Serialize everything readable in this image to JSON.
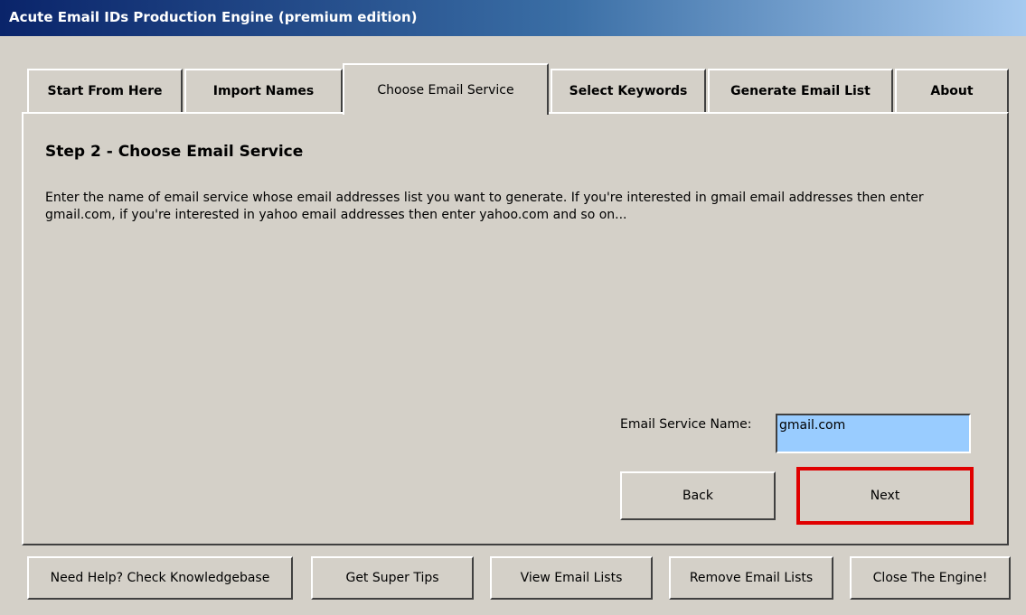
{
  "window": {
    "title": "Acute Email IDs Production Engine (premium edition)"
  },
  "tabs": [
    {
      "label": "Start From Here",
      "active": false
    },
    {
      "label": "Import Names",
      "active": false
    },
    {
      "label": "Choose Email Service",
      "active": true
    },
    {
      "label": "Select Keywords",
      "active": false
    },
    {
      "label": "Generate Email List",
      "active": false
    },
    {
      "label": "About",
      "active": false
    }
  ],
  "step": {
    "title": "Step 2 - Choose Email Service",
    "description": "Enter the name of email service whose email addresses list you want to generate. If you're interested in gmail email addresses then enter gmail.com, if you're interested in yahoo email addresses then enter yahoo.com and so on...",
    "field_label": "Email Service Name:",
    "field_value": "gmail.com",
    "field_bg_color": "#99ccff",
    "back_label": "Back",
    "next_label": "Next",
    "next_highlight_color": "#e00000"
  },
  "bottom_buttons": [
    {
      "label": "Need Help? Check Knowledgebase"
    },
    {
      "label": "Get Super Tips"
    },
    {
      "label": "View Email Lists"
    },
    {
      "label": "Remove Email Lists"
    },
    {
      "label": "Close The Engine!"
    }
  ]
}
